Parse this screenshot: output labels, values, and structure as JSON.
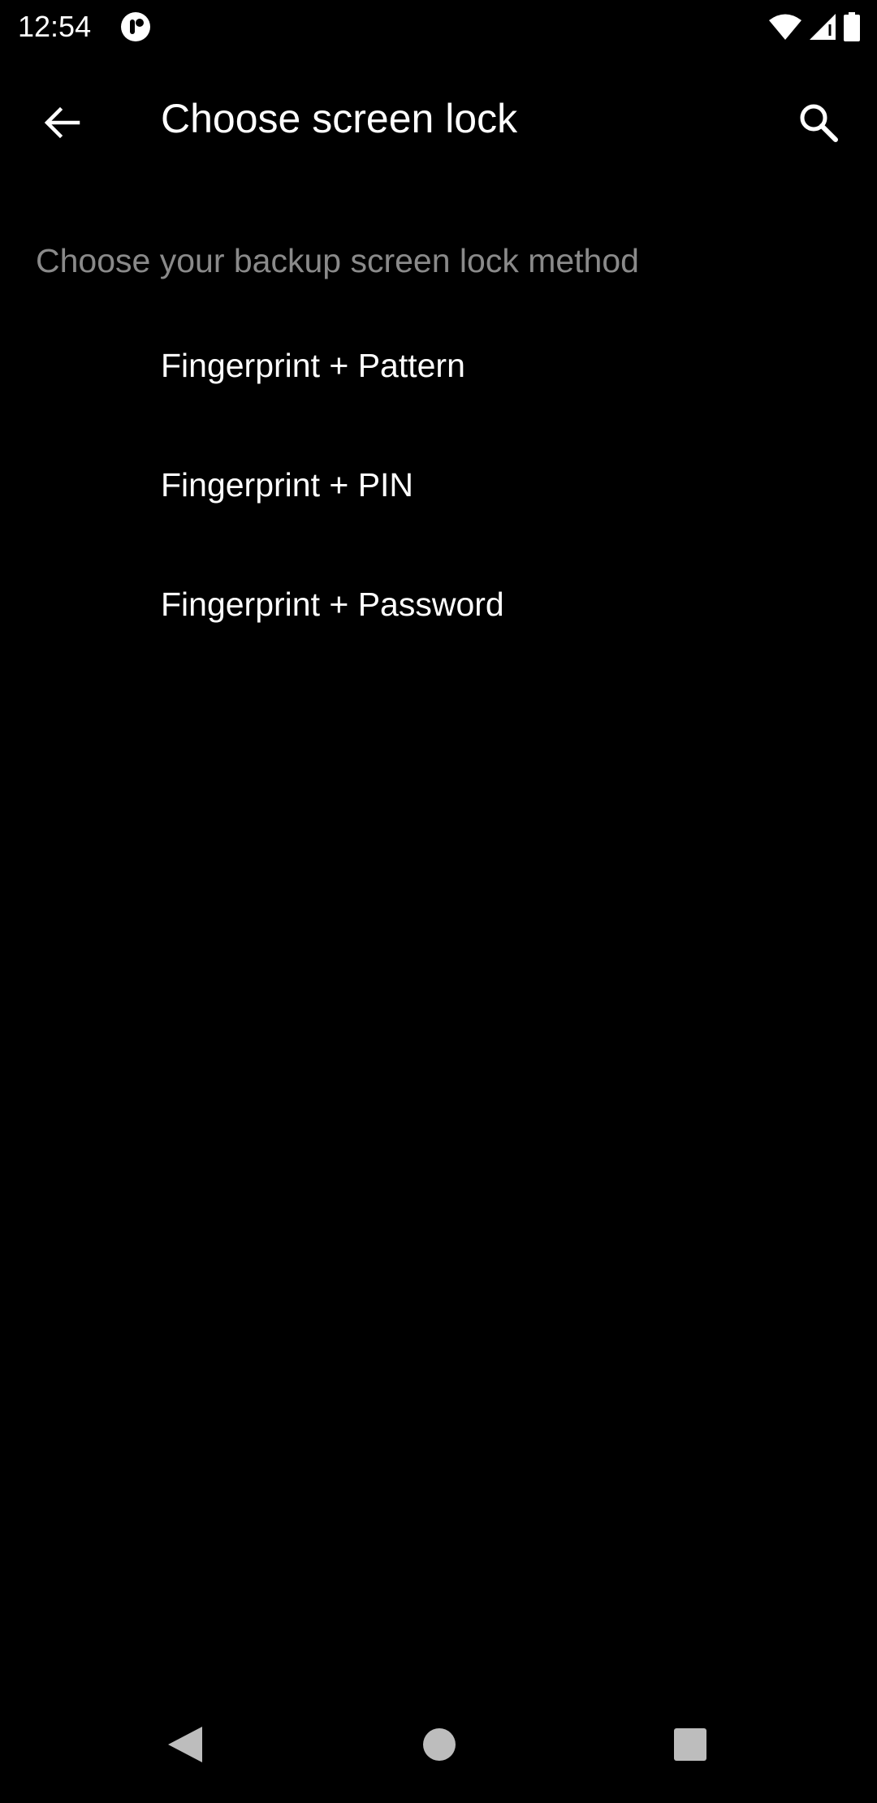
{
  "status_bar": {
    "time": "12:54",
    "icons": [
      "app-notification-icon",
      "wifi-icon",
      "signal-icon",
      "battery-icon"
    ]
  },
  "app_bar": {
    "title": "Choose screen lock",
    "back_icon": "arrow-back-icon",
    "search_icon": "search-icon"
  },
  "content": {
    "subheader": "Choose your backup screen lock method",
    "options": [
      {
        "label": "Fingerprint + Pattern"
      },
      {
        "label": "Fingerprint + PIN"
      },
      {
        "label": "Fingerprint + Password"
      }
    ]
  },
  "nav_bar": {
    "icons": [
      "nav-back-icon",
      "nav-home-icon",
      "nav-recents-icon"
    ]
  },
  "colors": {
    "background": "#000000",
    "primary_text": "#ffffff",
    "secondary_text": "#8a8a8a",
    "nav_icon": "#bdbdbd"
  }
}
